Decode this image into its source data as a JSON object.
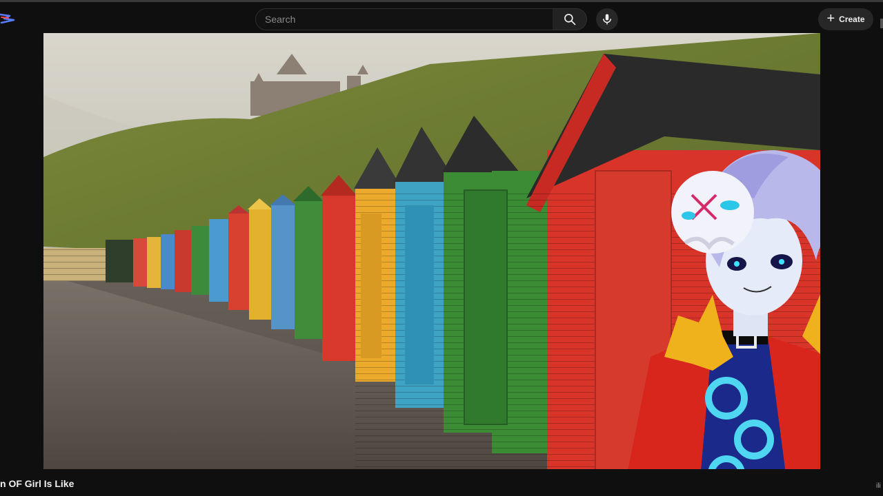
{
  "header": {
    "logo_icon": "app-logo-icon",
    "search": {
      "placeholder": "Search",
      "value": ""
    },
    "search_icon": "search-icon",
    "mic_icon": "microphone-icon",
    "create": {
      "icon": "plus-icon",
      "label": "Create"
    }
  },
  "player": {
    "content": "beach-huts-photo",
    "overlay": "vtuber-avatar"
  },
  "video": {
    "title": "n OF Girl Is Like"
  },
  "corner_mark": "ili",
  "colors": {
    "background": "#0f0f0f",
    "search_border": "#303030",
    "button_bg": "#272727",
    "text": "#f1f1f1"
  }
}
